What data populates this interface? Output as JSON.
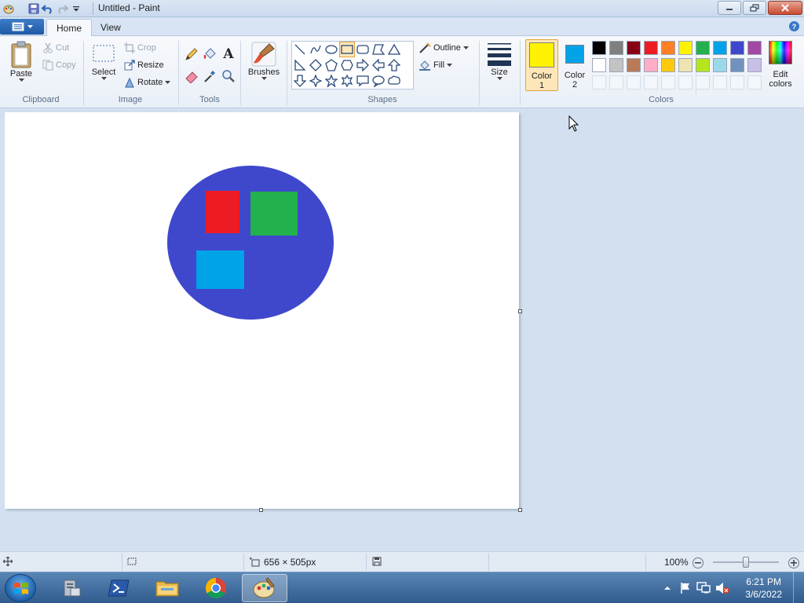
{
  "window": {
    "title": "Untitled - Paint",
    "file_menu_icon": "paint-menu-icon"
  },
  "tabs": [
    {
      "label": "Home",
      "active": true
    },
    {
      "label": "View",
      "active": false
    }
  ],
  "ribbon": {
    "clipboard": {
      "group_label": "Clipboard",
      "paste_label": "Paste",
      "cut_label": "Cut",
      "copy_label": "Copy"
    },
    "image": {
      "group_label": "Image",
      "select_label": "Select",
      "crop_label": "Crop",
      "resize_label": "Resize",
      "rotate_label": "Rotate"
    },
    "tools": {
      "group_label": "Tools",
      "items": [
        "pencil-icon",
        "fill-bucket-icon",
        "text-icon",
        "eraser-icon",
        "color-picker-icon",
        "magnifier-icon"
      ]
    },
    "brushes": {
      "label": "Brushes"
    },
    "shapes": {
      "group_label": "Shapes",
      "outline_label": "Outline",
      "fill_label": "Fill",
      "selected": "rectangle"
    },
    "size": {
      "label": "Size"
    },
    "colors": {
      "group_label": "Colors",
      "color1_label": "Color",
      "color1_num": "1",
      "color2_label": "Color",
      "color2_num": "2",
      "color1": "#FFF200",
      "color2": "#00A2E8",
      "edit_label": "Edit",
      "edit_label2": "colors",
      "palette_row1": [
        "#000000",
        "#7F7F7F",
        "#880015",
        "#ED1C24",
        "#FF7F27",
        "#FFF200",
        "#22B14C",
        "#00A2E8",
        "#3F48CC",
        "#A349A4"
      ],
      "palette_row2": [
        "#FFFFFF",
        "#C3C3C3",
        "#B97A57",
        "#FFAEC9",
        "#FFC90E",
        "#EFE4B0",
        "#B5E61D",
        "#99D9EA",
        "#7092BE",
        "#C8BFE7"
      ]
    }
  },
  "canvas": {
    "ellipse_color": "#3F48CC",
    "rects": [
      {
        "name": "red-rectangle",
        "color": "#ED1C24"
      },
      {
        "name": "green-rectangle",
        "color": "#22B14C"
      },
      {
        "name": "blue-rectangle",
        "color": "#00A2E8"
      }
    ]
  },
  "status": {
    "dimensions": "656 × 505px",
    "zoom": "100%"
  },
  "taskbar": {
    "apps": [
      "server-manager-icon",
      "powershell-icon",
      "file-explorer-icon",
      "chrome-icon",
      "paint-icon"
    ],
    "time": "6:21 PM",
    "date": "3/6/2022"
  }
}
